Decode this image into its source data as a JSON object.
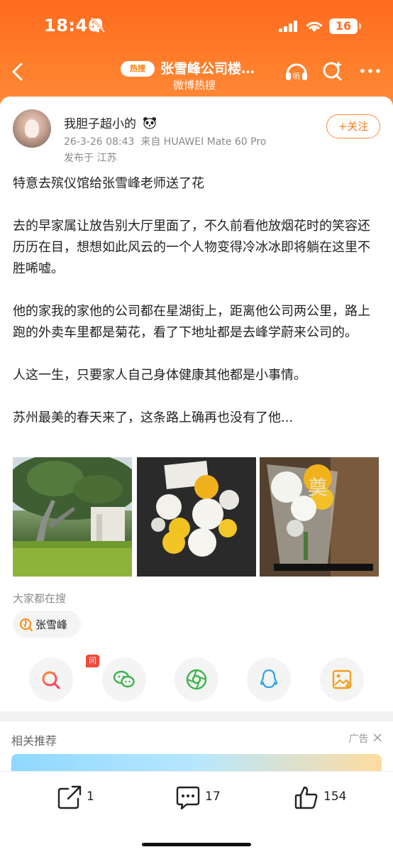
{
  "status_bar": {
    "time": "18:46",
    "battery": "16"
  },
  "nav": {
    "hot_badge": "热搜",
    "title": "张雪峰公司楼…",
    "subtitle": "微博热搜"
  },
  "post": {
    "username": "我胆子超小的",
    "date": "26-3-26 08:43",
    "source": "来自 HUAWEI Mate 60 Pro",
    "location": "发布于 江苏",
    "follow_label": "+关注",
    "paragraphs": [
      "特意去殡仪馆给张雪峰老师送了花",
      "去的早家属让放告别大厅里面了，不久前看他放烟花时的笑容还历历在目，想想如此风云的一个人物变得冷冰冰即将躺在这里不胜唏嘘。",
      "他的家我的家他的公司都在星湖街上，距离他公司两公里，路上跑的外卖车里都是菊花，看了下地址都是去峰学蔚来公司的。",
      "人这一生，只要家人自己身体健康其他都是小事情。",
      "苏州最美的春天来了，这条路上确再也没有了他..."
    ],
    "photo_overlay_text": "奠",
    "related_search_label": "大家都在搜",
    "related_search_chip": "张雪峰",
    "ai_badge": "问智搜"
  },
  "recommend": {
    "title": "相关推荐",
    "ad_label": "广告"
  },
  "bottom_bar": {
    "repost_count": "1",
    "comment_count": "17",
    "like_count": "154"
  },
  "colors": {
    "brand_orange": "#ff6a1f",
    "follow_orange": "#ff7a1a",
    "ai_red": "#f24a3a"
  },
  "icons": {
    "share_row": [
      "ai-search-icon",
      "wechat-icon",
      "moments-icon",
      "qq-icon",
      "save-image-icon"
    ]
  }
}
